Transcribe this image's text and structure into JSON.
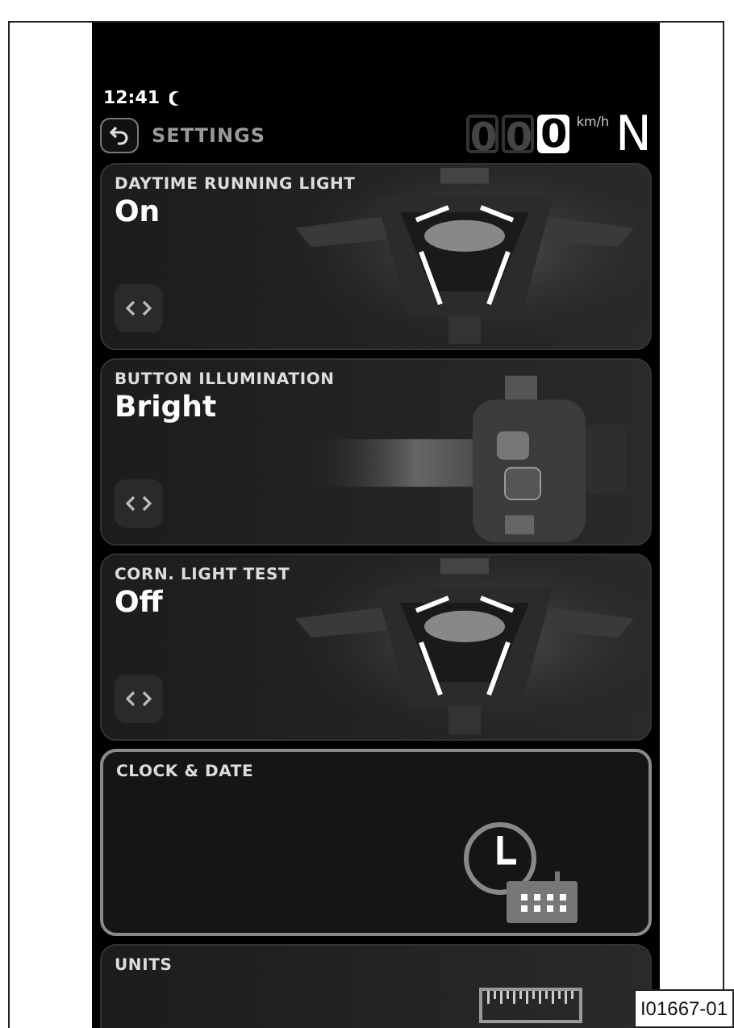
{
  "status_bar": {
    "time": "12:41"
  },
  "header": {
    "title": "SETTINGS",
    "speed_digits": [
      {
        "text": "0",
        "lit": false
      },
      {
        "text": "0",
        "lit": false
      },
      {
        "text": "0",
        "lit": true
      }
    ],
    "speed_unit": "km/h",
    "gear": "N"
  },
  "cards": [
    {
      "kind": "motorcycle",
      "title": "DAYTIME RUNNING LIGHT",
      "value": "On",
      "selected": false
    },
    {
      "kind": "handlebar",
      "title": "BUTTON ILLUMINATION",
      "value": "Bright",
      "selected": false
    },
    {
      "kind": "motorcycle",
      "title": "CORN. LIGHT TEST",
      "value": "Off",
      "selected": false
    },
    {
      "kind": "clock",
      "title": "CLOCK & DATE",
      "selected": true
    },
    {
      "kind": "units",
      "title": "UNITS",
      "selected": false
    }
  ],
  "figure_label": "I01667-01"
}
